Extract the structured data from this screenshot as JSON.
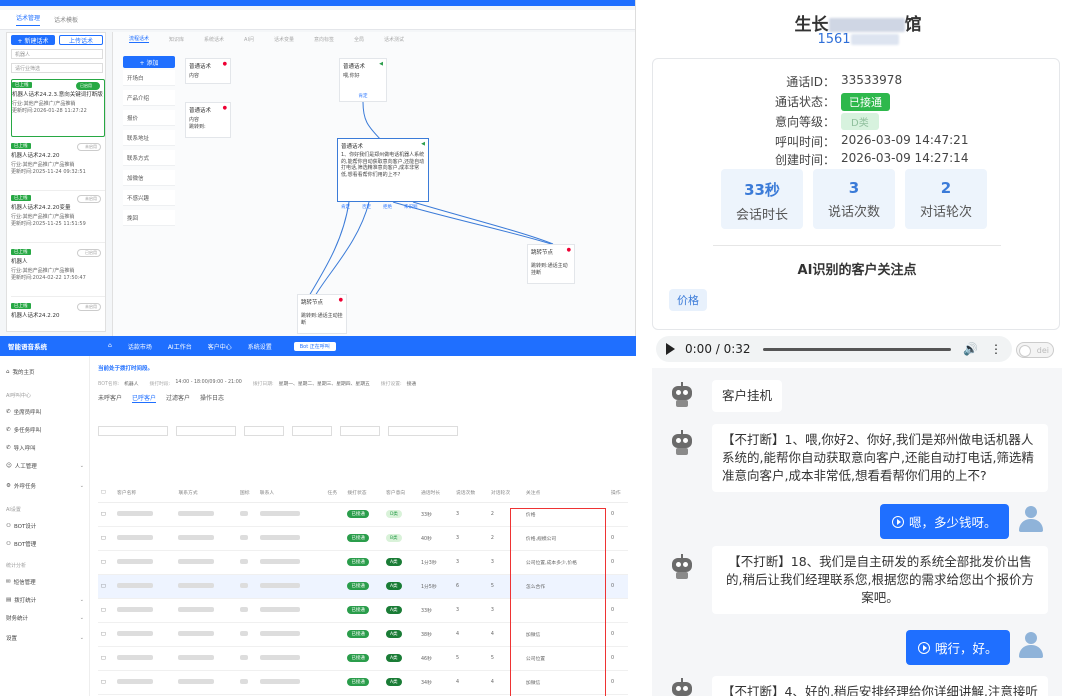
{
  "flow": {
    "tabs": [
      "话术管理",
      "话术模板"
    ],
    "new_btn": "+ 新建话术",
    "upload_btn": "上传话术",
    "search_value": "机器人",
    "filter_placeholder": "请行业筛选",
    "cards": [
      {
        "tag": "已上线",
        "name": "机器人话术24.2.3.意向关键词打断版",
        "industry": "行业:其他产品推广/产品推销",
        "updated": "更新时间:2026-01-28 11:27:22",
        "toggle": "已启用",
        "on": true
      },
      {
        "tag": "已上线",
        "name": "机器人话术24.2.20",
        "industry": "行业:其他产品推广/产品推销",
        "updated": "更新时间:2025-11-24 09:32:51",
        "toggle": "未启用",
        "on": false
      },
      {
        "tag": "已上线",
        "name": "机器人话术24.2.20变量",
        "industry": "行业:其他产品推广/产品推销",
        "updated": "更新时间:2025-11-25 11:51:59",
        "toggle": "未启用",
        "on": false
      },
      {
        "tag": "已上线",
        "name": "机器人",
        "industry": "行业:其他产品推广/产品推销",
        "updated": "更新时间:2024-02-22 17:50:47",
        "toggle": "已启用",
        "on": true
      },
      {
        "tag": "已上线",
        "name": "机器人话术24.2.20",
        "industry": "",
        "updated": "",
        "toggle": "未启用",
        "on": false
      }
    ],
    "canvas_tabs": [
      "流程话术",
      "知识库",
      "系统话术",
      "AI问",
      "话术变量",
      "意向标签",
      "全局",
      "话术测试"
    ],
    "add_btn": "+ 添加",
    "categories": [
      "开场白",
      "产品介绍",
      "报价",
      "联系地址",
      "联系方式",
      "加微信",
      "不感兴趣",
      "挽回"
    ],
    "nodes": {
      "n1": {
        "title": "普通话术",
        "body": "内容"
      },
      "n2": {
        "title": "普通话术",
        "body": "喂,你好"
      },
      "n2_branch": "肯定",
      "n3": {
        "title": "普通话术",
        "body": "内容",
        "extra": "跳转到:"
      },
      "n4": {
        "title": "普通话术",
        "body": "1、你好我们是郑州做电话机器人系统的,能帮你自动获取意向客户,还能自动打电话,筛选精准意向客户,成本非常低,想看看帮你们用的上不?"
      },
      "n4_branches": [
        "肯定",
        "否定",
        "拒绝",
        "未识别"
      ],
      "n5": {
        "title": "跳转节点",
        "body": "跳转到:通话主动挂断"
      },
      "n6": {
        "title": "跳转节点",
        "body": "跳转到:通话主动挂断"
      }
    }
  },
  "crm": {
    "logo": "智能语音系统",
    "nav": [
      "话款市场",
      "AI工作台",
      "客户中心",
      "系统设置"
    ],
    "live": "Bot 正在呼叫",
    "sidebar": [
      {
        "label": "我的主页"
      },
      {
        "head": "AI呼叫中心"
      },
      {
        "label": "坐席员呼叫"
      },
      {
        "label": "多任务呼叫"
      },
      {
        "label": "导入呼叫"
      },
      {
        "label": "人工管理",
        "caret": true
      },
      {
        "label": "外呼任务",
        "caret": true
      },
      {
        "head": "AI设置"
      },
      {
        "label": "BOT设计"
      },
      {
        "label": "BOT管理"
      },
      {
        "head": "统计分析"
      },
      {
        "label": "短信管理"
      },
      {
        "label": "拨打统计",
        "caret": true
      },
      {
        "label": "财务统计",
        "caret": true
      },
      {
        "label": "设置",
        "caret": true
      }
    ],
    "notice": "当前处于拨打时间段。",
    "row1": [
      "BOT名称:",
      "机器人",
      "拨打时段:",
      "14:00 - 18:00/09:00 - 21:00",
      "拨打日期:",
      "星期一、星期二、星期三、星期四、星期五",
      "拨打设置:",
      "接通"
    ],
    "tabs": [
      "未呼客户",
      "已呼客户",
      "过滤客户",
      "操作日志"
    ],
    "columns": [
      "客户名称",
      "联系方式",
      "国标",
      "联系人",
      "任务",
      "拨打状态",
      "客户意向",
      "通话时长",
      "说话次数",
      "对话轮次",
      "关注点",
      "操作"
    ],
    "rows": [
      {
        "status": "已接通",
        "intent": "D类",
        "intent_style": "lg",
        "dur": "33秒",
        "say": "3",
        "turn": "2",
        "focus": "价格"
      },
      {
        "status": "已接通",
        "intent": "B类",
        "intent_style": "lg",
        "dur": "40秒",
        "say": "3",
        "turn": "2",
        "focus": "价格,规模公司"
      },
      {
        "status": "已接通",
        "intent": "A类",
        "intent_style": "dg",
        "dur": "1分3秒",
        "say": "3",
        "turn": "3",
        "focus": "公司位置,成本多少,价格"
      },
      {
        "status": "已接通",
        "intent": "A类",
        "intent_style": "dg",
        "dur": "1分5秒",
        "say": "6",
        "turn": "5",
        "focus": "怎么合作"
      },
      {
        "status": "已接通",
        "intent": "A类",
        "intent_style": "dg",
        "dur": "33秒",
        "say": "3",
        "turn": "3",
        "focus": ""
      },
      {
        "status": "已接通",
        "intent": "A类",
        "intent_style": "dg",
        "dur": "38秒",
        "say": "4",
        "turn": "4",
        "focus": "加微信"
      },
      {
        "status": "已接通",
        "intent": "A类",
        "intent_style": "dg",
        "dur": "46秒",
        "say": "5",
        "turn": "5",
        "focus": "公司位置"
      },
      {
        "status": "已接通",
        "intent": "A类",
        "intent_style": "dg",
        "dur": "34秒",
        "say": "4",
        "turn": "4",
        "focus": "加微信"
      }
    ]
  },
  "detail": {
    "title_a": "生长",
    "title_b": "馆",
    "phone": "1561",
    "call_id_label": "通话ID：",
    "call_id": "33533978",
    "status_label": "通话状态：",
    "status": "已接通",
    "intent_label": "意向等级：",
    "intent": "D类",
    "call_time_label": "呼叫时间：",
    "call_time": "2026-03-09 14:47:21",
    "create_time_label": "创建时间：",
    "create_time": "2026-03-09 14:27:14",
    "stats": [
      {
        "value": "33秒",
        "label": "会话时长"
      },
      {
        "value": "3",
        "label": "说话次数"
      },
      {
        "value": "2",
        "label": "对话轮次"
      }
    ],
    "ai_title": "AI识别的客户关注点",
    "focus_tag": "价格",
    "audio_time": "0:00 / 0:32",
    "toggle_label": "dei"
  },
  "chat": [
    {
      "from": "bot",
      "text": "客户挂机"
    },
    {
      "from": "bot",
      "text": "【不打断】1、喂,你好2、你好,我们是郑州做电话机器人系统的,能帮你自动获取意向客户,还能自动打电话,筛选精准意向客户,成本非常低,想看看帮你们用的上不?"
    },
    {
      "from": "user",
      "text": "嗯，多少钱呀。"
    },
    {
      "from": "bot",
      "text": "【不打断】18、我们是自主研发的系统全部批发价出售的,稍后让我们经理联系您,根据您的需求给您出个报价方案吧。"
    },
    {
      "from": "user",
      "text": "哦行，好。"
    },
    {
      "from": "bot",
      "text": "【不打断】4、好的,稍后安排经理给你详细讲解,注意接听"
    }
  ]
}
